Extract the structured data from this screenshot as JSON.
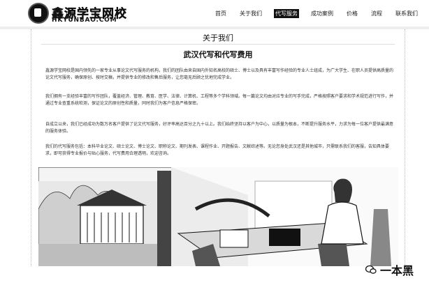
{
  "header": {
    "logo_cn": "鑫源学宝网校",
    "logo_en": "HKYUNBAO.COM",
    "nav": [
      {
        "label": "首页",
        "active": false
      },
      {
        "label": "关于我们",
        "active": false
      },
      {
        "label": "代写服务",
        "active": true
      },
      {
        "label": "成功案例",
        "active": false
      },
      {
        "label": "价格",
        "active": false
      },
      {
        "label": "流程",
        "active": false
      },
      {
        "label": "联系我们",
        "active": false
      }
    ]
  },
  "main": {
    "page_title": "关于我们",
    "article_title": "武汉代写和代写费用",
    "paragraphs": [
      "鑫源学宝网校是国内领先的一家专业从事论文代写服务的机构，我们的团队由来自国内外知名高校的硕士、博士以及具有丰富写作经验的专业人士组成，为广大学生、在职人员提供高质量的论文代写服务，确保原创、按时交稿，并提供专业的修改和售后服务，让您毫无后顾之忧地完成学业。",
      "我们拥有一支经验丰富的写作团队，覆盖经济、管理、教育、医学、法律、计算机、工程等多个学科领域。每一篇论文均由对应专业的写手完成，严格按照客户要求和学术规范进行写作，并通过专业查重系统检测，保证论文的原创性和质量，同时我们为客户信息严格保密。",
      "自成立以来，我们已经成功为数万名客户提供了论文代写服务，好评率高达百分之九十以上。我们始终坚持以客户为中心，以质量为根本，不断提升服务水平，力求为每一位客户提供最满意的服务体验。",
      "我们的代写服务包括：本科毕业论文、硕士论文、博士论文、职称论文、期刊发表、课程作业、开题报告、文献综述等。无论您身处武汉还是其他城市，只需联系我们的客服，告知具体要求，即可获得专业报价与贴心服务，代写费用合理透明，欢迎咨询。"
    ]
  },
  "watermark": {
    "text": "一本黑"
  },
  "colors": {
    "active_nav_bg": "#111111",
    "header_border": "#c8c8c8"
  }
}
